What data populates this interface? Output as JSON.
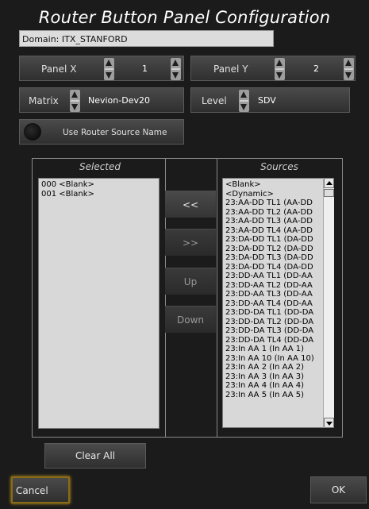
{
  "title": "Router Button Panel Configuration",
  "domain": "Domain: ITX_STANFORD",
  "panel_x": {
    "label": "Panel X",
    "value": "1"
  },
  "panel_y": {
    "label": "Panel Y",
    "value": "2"
  },
  "matrix": {
    "label": "Matrix",
    "value": "Nevion-Dev20"
  },
  "level": {
    "label": "Level",
    "value": "SDV"
  },
  "use_router_source_name": "Use Router Source Name",
  "selected": {
    "header": "Selected",
    "items": [
      "000 <Blank>",
      "001 <Blank>"
    ]
  },
  "sources": {
    "header": "Sources",
    "items": [
      "<Blank>",
      "<Dynamic>",
      "23:AA-DD TL1 (AA-DD",
      "23:AA-DD TL2 (AA-DD",
      "23:AA-DD TL3 (AA-DD",
      "23:AA-DD TL4 (AA-DD",
      "23:DA-DD TL1 (DA-DD",
      "23:DA-DD TL2 (DA-DD",
      "23:DA-DD TL3 (DA-DD",
      "23:DA-DD TL4 (DA-DD",
      "23:DD-AA TL1 (DD-AA",
      "23:DD-AA TL2 (DD-AA",
      "23:DD-AA TL3 (DD-AA",
      "23:DD-AA TL4 (DD-AA",
      "23:DD-DA TL1 (DD-DA",
      "23:DD-DA TL2 (DD-DA",
      "23:DD-DA TL3 (DD-DA",
      "23:DD-DA TL4 (DD-DA",
      "23:In AA 1 (In AA 1)",
      "23:In AA 10 (In AA 10)",
      "23:In AA 2 (In AA 2)",
      "23:In AA 3 (In AA 3)",
      "23:In AA 4 (In AA 4)",
      "23:In AA 5 (In AA 5)"
    ]
  },
  "buttons": {
    "add": "<<",
    "remove": ">>",
    "up": "Up",
    "down": "Down",
    "clear_all": "Clear All",
    "cancel": "Cancel",
    "ok": "OK"
  }
}
